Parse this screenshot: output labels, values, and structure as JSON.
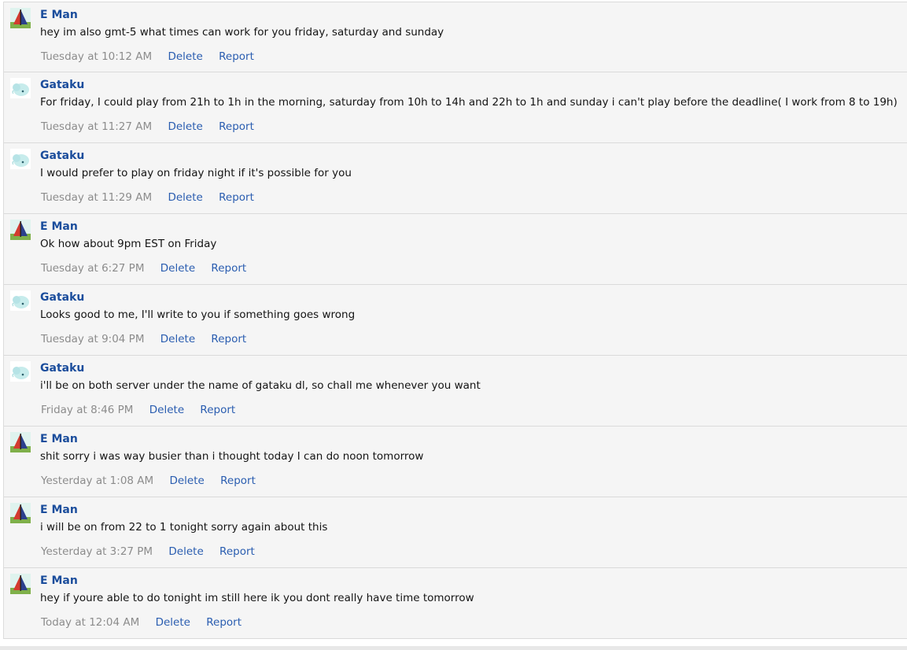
{
  "avatars": {
    "eman": "sailboat-avatar",
    "gataku": "bird-avatar"
  },
  "colors": {
    "author": "#1b4d9c",
    "action": "#2a5db0",
    "timestamp": "#8c8c8c",
    "row_bg": "#f5f5f5"
  },
  "messages": [
    {
      "author": "E Man",
      "avatar": "eman",
      "text": "hey im also gmt-5 what times can work for you friday, saturday and sunday",
      "time": "Tuesday at 10:12 AM",
      "delete": "Delete",
      "report": "Report"
    },
    {
      "author": "Gataku",
      "avatar": "gataku",
      "text": "For friday, I could play from 21h to 1h in the morning, saturday from 10h to 14h and 22h to 1h and sunday i can't play before the deadline( I work from 8 to 19h)",
      "time": "Tuesday at 11:27 AM",
      "delete": "Delete",
      "report": "Report"
    },
    {
      "author": "Gataku",
      "avatar": "gataku",
      "text": "I would prefer to play on friday night if it's possible for you",
      "time": "Tuesday at 11:29 AM",
      "delete": "Delete",
      "report": "Report"
    },
    {
      "author": "E Man",
      "avatar": "eman",
      "text": "Ok how about 9pm EST on Friday",
      "time": "Tuesday at 6:27 PM",
      "delete": "Delete",
      "report": "Report"
    },
    {
      "author": "Gataku",
      "avatar": "gataku",
      "text": "Looks good to me, I'll write to you if something goes wrong",
      "time": "Tuesday at 9:04 PM",
      "delete": "Delete",
      "report": "Report"
    },
    {
      "author": "Gataku",
      "avatar": "gataku",
      "text": "i'll be on both server under the name of gataku dl, so chall me whenever you want",
      "time": "Friday at 8:46 PM",
      "delete": "Delete",
      "report": "Report"
    },
    {
      "author": "E Man",
      "avatar": "eman",
      "text": "shit sorry i was way busier than i thought today I can do noon tomorrow",
      "time": "Yesterday at 1:08 AM",
      "delete": "Delete",
      "report": "Report"
    },
    {
      "author": "E Man",
      "avatar": "eman",
      "text": "i will be on from 22 to 1 tonight sorry again about this",
      "time": "Yesterday at 3:27 PM",
      "delete": "Delete",
      "report": "Report"
    },
    {
      "author": "E Man",
      "avatar": "eman",
      "text": "hey if youre able to do tonight im still here ik you dont really have time tomorrow",
      "time": "Today at 12:04 AM",
      "delete": "Delete",
      "report": "Report"
    }
  ]
}
